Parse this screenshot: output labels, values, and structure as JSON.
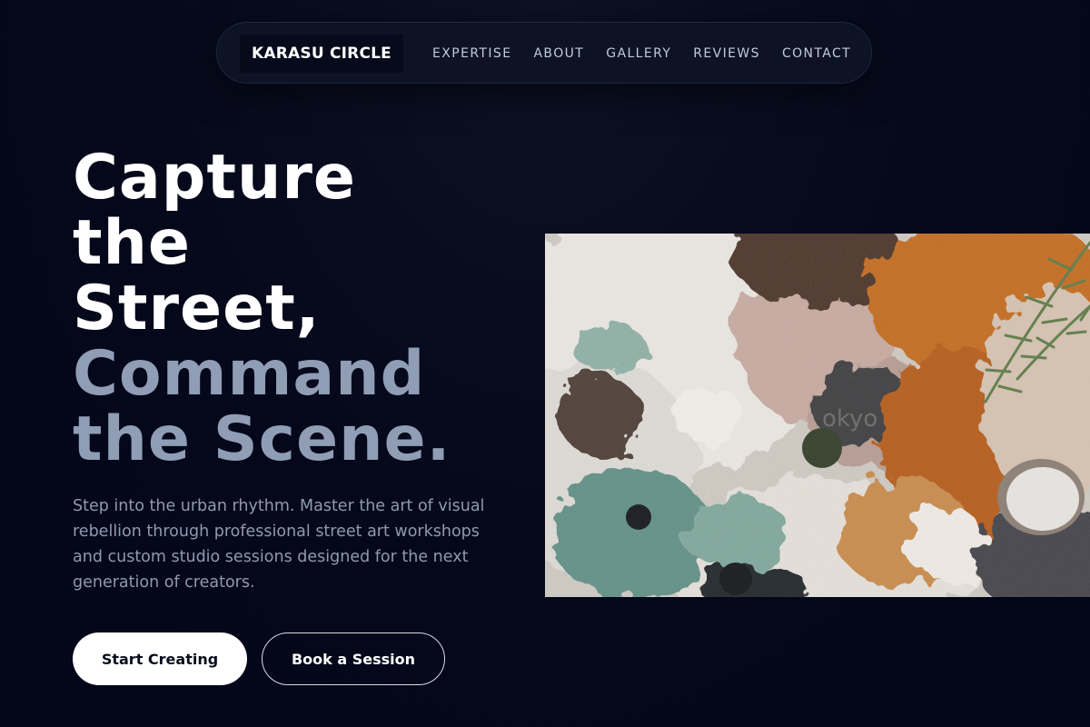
{
  "nav": {
    "brand": "KARASU CIRCLE",
    "links": [
      "EXPERTISE",
      "ABOUT",
      "GALLERY",
      "REVIEWS",
      "CONTACT"
    ]
  },
  "hero": {
    "headline_lines": [
      "Capture",
      "the",
      "Street,",
      "Command",
      "the Scene."
    ],
    "subtitle": "Step into the urban rhythm. Master the art of visual rebellion through professional street art workshops and custom studio sessions designed for the next generation of creators.",
    "primary_button": "Start Creating",
    "secondary_button": "Book a Session",
    "image_watermark": "okyo"
  },
  "colors": {
    "background": "#05081a",
    "nav_background": "#0d1224",
    "headline_white": "#ffffff",
    "headline_muted": "#8f9db5",
    "subtitle": "#8f9aae"
  }
}
